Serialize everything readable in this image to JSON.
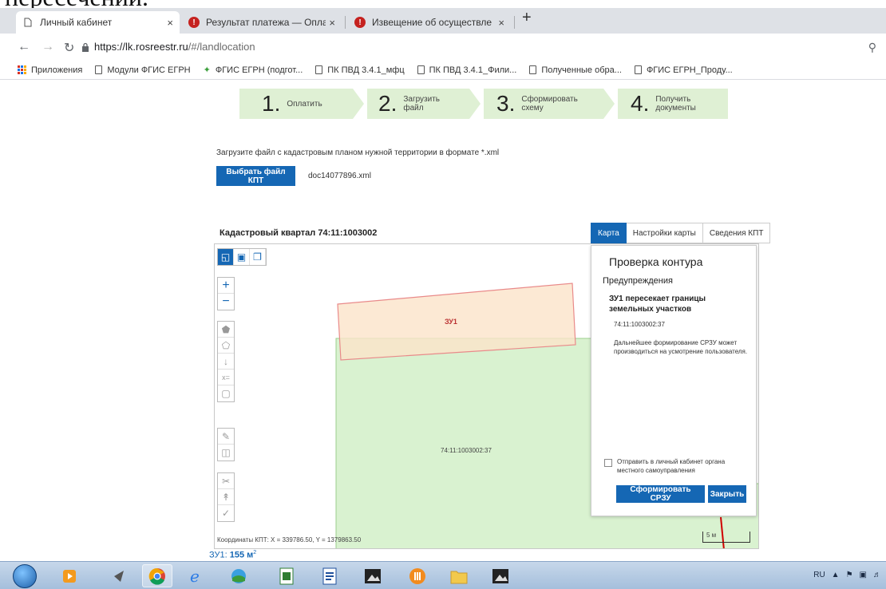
{
  "top_cropped_text": "пересечении.",
  "browser": {
    "tabs": [
      {
        "title": "Личный кабинет",
        "icon": "page-icon",
        "active": true
      },
      {
        "title": "Результат платежа — Оплата го",
        "icon": "error-icon",
        "active": false
      },
      {
        "title": "Извещение об осуществлении",
        "icon": "error-icon",
        "active": false
      }
    ],
    "close_glyph": "×",
    "new_tab_glyph": "+",
    "url_host": "https://lk.rosreestr.ru",
    "url_path": "/#/landlocation",
    "bookmarks": [
      {
        "label": "Приложения",
        "icon": "apps-icon"
      },
      {
        "label": "Модули ФГИС ЕГРН",
        "icon": "page-icon"
      },
      {
        "label": "ФГИС ЕГРН (подгот...",
        "icon": "leaf-icon"
      },
      {
        "label": "ПК ПВД 3.4.1_мфц",
        "icon": "page-icon"
      },
      {
        "label": "ПК ПВД 3.4.1_Фили...",
        "icon": "page-icon"
      },
      {
        "label": "Полученные обра...",
        "icon": "page-icon"
      },
      {
        "label": "ФГИС ЕГРН_Проду...",
        "icon": "page-icon"
      }
    ]
  },
  "steps": [
    {
      "num": "1.",
      "label": "Оплатить"
    },
    {
      "num": "2.",
      "label": "Загрузить файл"
    },
    {
      "num": "3.",
      "label": "Сформировать схему"
    },
    {
      "num": "4.",
      "label": "Получить документы"
    }
  ],
  "upload": {
    "hint": "Загрузите файл с кадастровым планом нужной территории в формате *.xml",
    "button_label": "Выбрать файл КПТ",
    "filename": "doc14077896.xml"
  },
  "map": {
    "title": "Кадастровый квартал 74:11:1003002",
    "tabs": [
      "Карта",
      "Настройки карты",
      "Сведения КПТ"
    ],
    "zu_label": "ЗУ1",
    "parcel_label": "74:11:1003002:37",
    "zoom_in": "+",
    "zoom_out": "−",
    "coords": "Координаты КПТ: X = 339786.50, Y = 1379863.50",
    "scale": "5 м"
  },
  "panel": {
    "title": "Проверка контура",
    "subtitle": "Предупреждения",
    "warning": "ЗУ1 пересекает границы земельных участков",
    "cadastral": "74:11:1003002:37",
    "note": "Дальнейшее формирование СРЗУ может производиться на усмотрение пользователя.",
    "checkbox_label": "Отправить в личный кабинет органа местного самоуправления",
    "form_button": "Сформировать СРЗУ",
    "close_button": "Закрыть"
  },
  "area": {
    "label": "ЗУ1:",
    "value": "155 м",
    "sup": "2"
  },
  "tray": {
    "lang": "RU"
  },
  "colors": {
    "accent": "#1567b4",
    "step_bg": "#dff0d4",
    "parcel_fill": "#d9f2d0",
    "zu_fill": "#fbe3c9",
    "zu_stroke": "#e98a8a"
  }
}
